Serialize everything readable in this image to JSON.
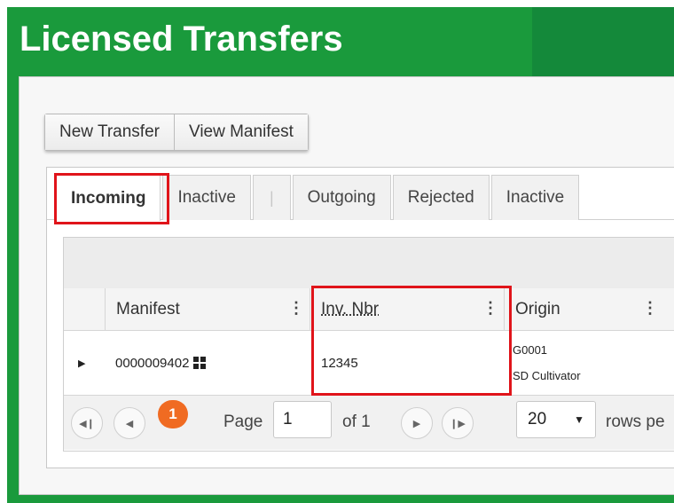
{
  "window": {
    "title": "Licensed Transfers"
  },
  "toolbar": {
    "new_transfer": "New Transfer",
    "view_manifest": "View Manifest"
  },
  "tabs": [
    {
      "label": "Incoming",
      "active": true
    },
    {
      "label": "Inactive"
    },
    {
      "label": "|"
    },
    {
      "label": "Outgoing"
    },
    {
      "label": "Rejected"
    },
    {
      "label": "Inactive"
    }
  ],
  "grid": {
    "columns": [
      "Manifest",
      "Inv. Nbr",
      "Origin"
    ],
    "rows": [
      {
        "manifest": "0000009402",
        "inv_nbr": "12345",
        "origin_license": "G0001",
        "origin_name": "SD Cultivator"
      }
    ]
  },
  "pager": {
    "current_page": "1",
    "page_label": "Page",
    "page_input": "1",
    "of_label": "of 1",
    "page_size": "20",
    "rows_label": "rows pe"
  },
  "colors": {
    "header_green": "#1a9a3c",
    "pager_accent": "#f06b22",
    "highlight": "#e0141a"
  }
}
